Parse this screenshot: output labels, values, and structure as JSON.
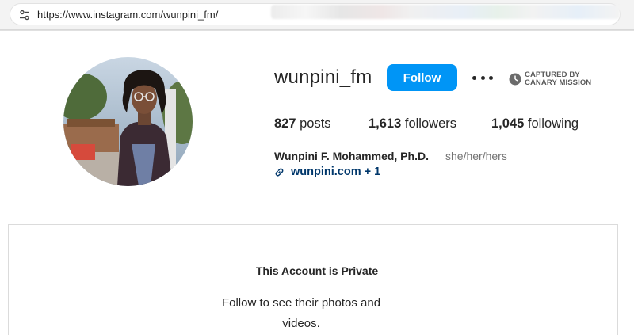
{
  "browser": {
    "url": "https://www.instagram.com/wunpini_fm/",
    "site_icon": "tune-icon"
  },
  "profile": {
    "username": "wunpini_fm",
    "follow_label": "Follow",
    "more_icon": "more-horizontal-icon",
    "capture_badge": {
      "line1": "CAPTURED BY",
      "line2": "CANARY MISSION"
    },
    "stats": {
      "posts_count": "827",
      "posts_label": " posts",
      "followers_count": "1,613",
      "followers_label": " followers",
      "following_count": "1,045",
      "following_label": " following"
    },
    "full_name": "Wunpini F. Mohammed, Ph.D.",
    "pronouns": "she/her/hers",
    "link_text": "wunpini.com + 1"
  },
  "private_notice": {
    "title": "This Account is Private",
    "description": "Follow to see their photos and videos."
  },
  "colors": {
    "follow_button": "#0095f6",
    "link": "#00376b",
    "secondary_text": "#737373"
  }
}
